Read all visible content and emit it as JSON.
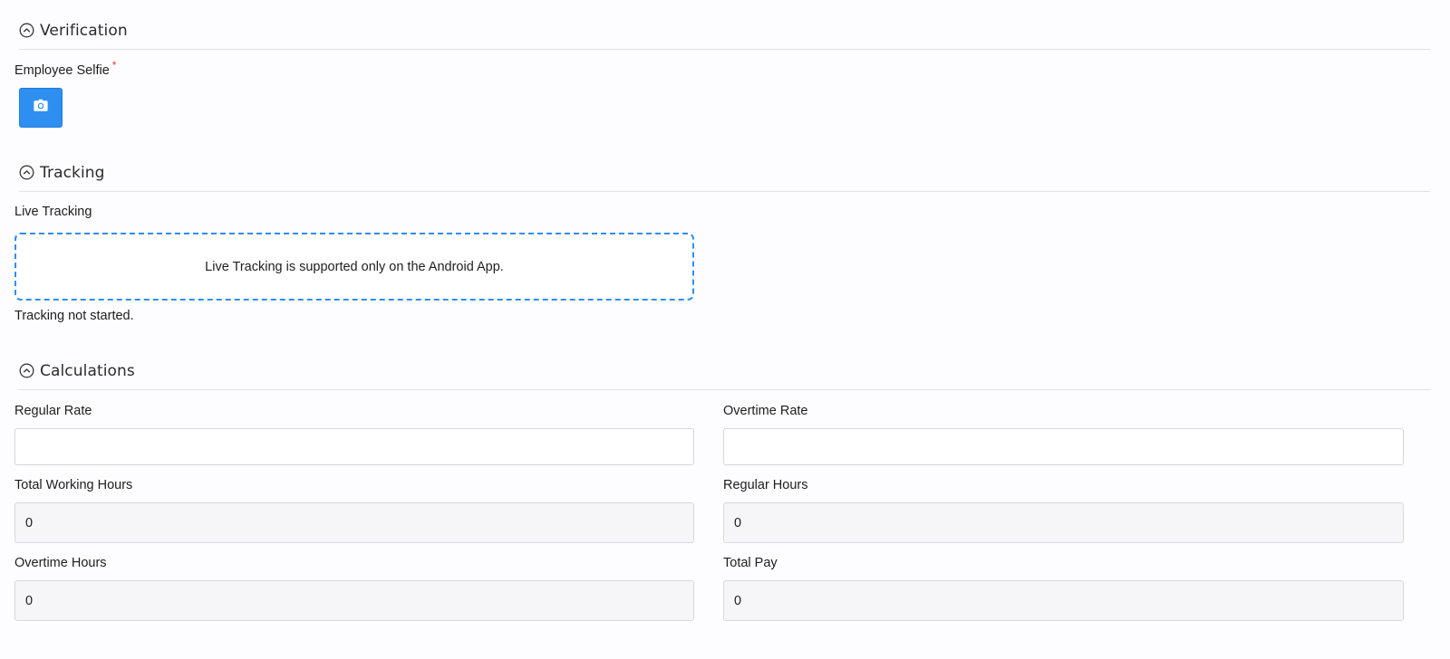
{
  "sections": {
    "verification": {
      "title": "Verification"
    },
    "tracking": {
      "title": "Tracking"
    },
    "calculations": {
      "title": "Calculations"
    }
  },
  "verification": {
    "employee_selfie_label": "Employee Selfie",
    "required_mark": "*",
    "camera_icon": "camera-icon"
  },
  "tracking": {
    "live_tracking_label": "Live Tracking",
    "notice": "Live Tracking is supported only on the Android App.",
    "status": "Tracking not started."
  },
  "calculations": {
    "regular_rate": {
      "label": "Regular Rate",
      "value": ""
    },
    "overtime_rate": {
      "label": "Overtime Rate",
      "value": ""
    },
    "total_working_hours": {
      "label": "Total Working Hours",
      "value": "0"
    },
    "regular_hours": {
      "label": "Regular Hours",
      "value": "0"
    },
    "overtime_hours": {
      "label": "Overtime Hours",
      "value": "0"
    },
    "total_pay": {
      "label": "Total Pay",
      "value": "0"
    }
  },
  "colors": {
    "accent": "#2f8ff0",
    "required": "#e53935",
    "readonly_bg": "#f6f5f8"
  }
}
